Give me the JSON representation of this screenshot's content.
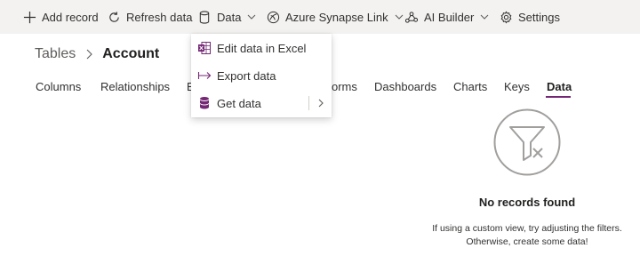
{
  "toolbar": {
    "add_record": "Add record",
    "refresh_data": "Refresh data",
    "data": "Data",
    "azure_synapse_link": "Azure Synapse Link",
    "ai_builder": "AI Builder",
    "settings": "Settings"
  },
  "breadcrumb": {
    "root": "Tables",
    "current": "Account"
  },
  "tabs": {
    "columns": "Columns",
    "relationships": "Relationships",
    "business_rules_partial": "B",
    "forms_partial": "orms",
    "dashboards": "Dashboards",
    "charts": "Charts",
    "keys": "Keys",
    "data": "Data",
    "active": "Data"
  },
  "data_menu": {
    "items": [
      {
        "label": "Edit data in Excel",
        "icon": "excel-icon"
      },
      {
        "label": "Export data",
        "icon": "export-arrow-icon"
      },
      {
        "label": "Get data",
        "icon": "database-icon",
        "has_submenu": true
      }
    ]
  },
  "empty_state": {
    "icon": "filter-clear-icon",
    "title": "No records found",
    "line1": "If using a custom view, try adjusting the filters.",
    "line2": "Otherwise, create some data!"
  },
  "colors": {
    "accent": "#742774",
    "toolbar_bg": "#f3f2f1"
  }
}
